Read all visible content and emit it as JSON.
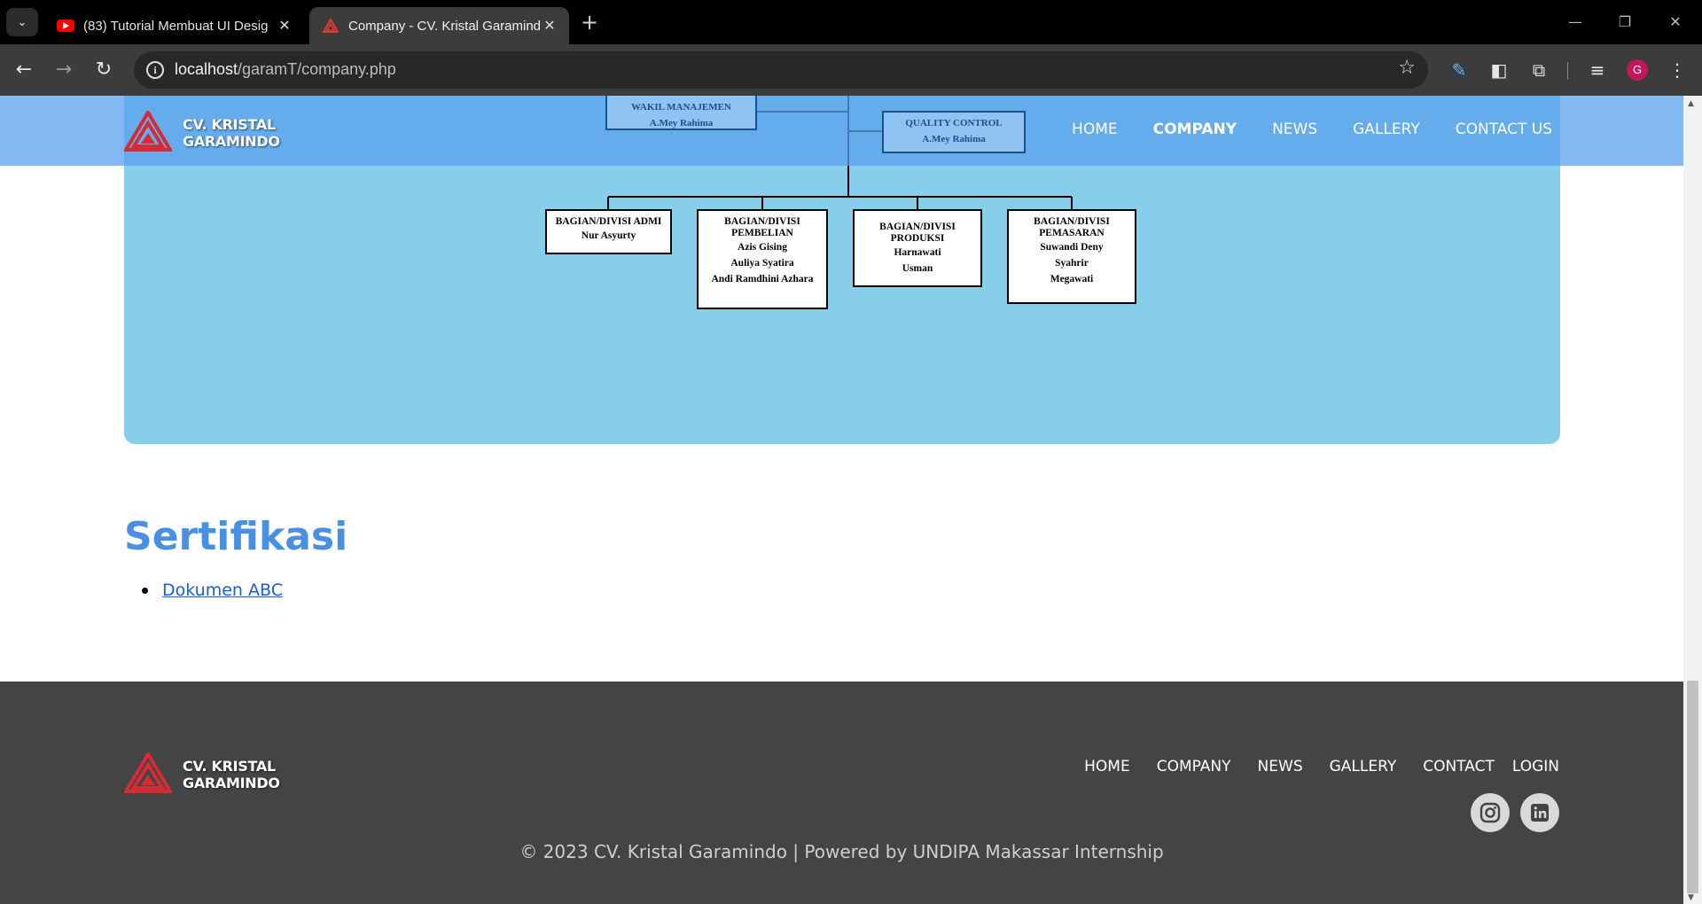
{
  "browser": {
    "tabs": [
      {
        "title": "(83) Tutorial Membuat UI Desig",
        "favicon": "youtube-icon",
        "active": false
      },
      {
        "title": "Company - CV. Kristal Garamindo",
        "favicon": "triangle-logo-icon",
        "active": true
      }
    ],
    "url_host": "localhost",
    "url_path": "/garamT/company.php",
    "profile_initial": "G"
  },
  "header": {
    "brand_line1": "CV. KRISTAL",
    "brand_line2": "GARAMINDO",
    "nav": [
      "HOME",
      "COMPANY",
      "NEWS",
      "GALLERY",
      "CONTACT US"
    ],
    "active_nav": "COMPANY"
  },
  "org_chart": {
    "wakil": {
      "title": "WAKIL MANAJEMEN",
      "names": [
        "A.Mey Rahima"
      ]
    },
    "qc": {
      "title": "QUALITY CONTROL",
      "names": [
        "A.Mey Rahima"
      ]
    },
    "divisions": [
      {
        "title": "BAGIAN/DIVISI ADMI",
        "names": [
          "Nur Asyurty"
        ]
      },
      {
        "title": "BAGIAN/DIVISI PEMBELIAN",
        "names": [
          "Azis Gising",
          "Auliya Syatira",
          "Andi Ramdhini Azhara"
        ]
      },
      {
        "title": "BAGIAN/DIVISI PRODUKSI",
        "names": [
          "Harnawati",
          "Usman"
        ]
      },
      {
        "title": "BAGIAN/DIVISI PEMASARAN",
        "names": [
          "Suwandi Deny",
          "Syahrir",
          "Megawati"
        ]
      }
    ]
  },
  "certification": {
    "heading": "Sertifikasi",
    "documents": [
      "Dokumen ABC"
    ]
  },
  "footer": {
    "brand_line1": "CV. KRISTAL",
    "brand_line2": "GARAMINDO",
    "links": [
      "HOME",
      "COMPANY",
      "NEWS",
      "GALLERY",
      "CONTACT",
      "LOGIN"
    ],
    "socials": [
      "instagram-icon",
      "linkedin-icon"
    ],
    "copyright": "© 2023 CV. Kristal Garamindo | Powered by UNDIPA Makassar Internship"
  },
  "colors": {
    "navbar": "#5aa0ec",
    "org_panel": "#87ceeb",
    "heading": "#4a90e2",
    "footer": "#444444",
    "logo_red": "#d62b35"
  }
}
